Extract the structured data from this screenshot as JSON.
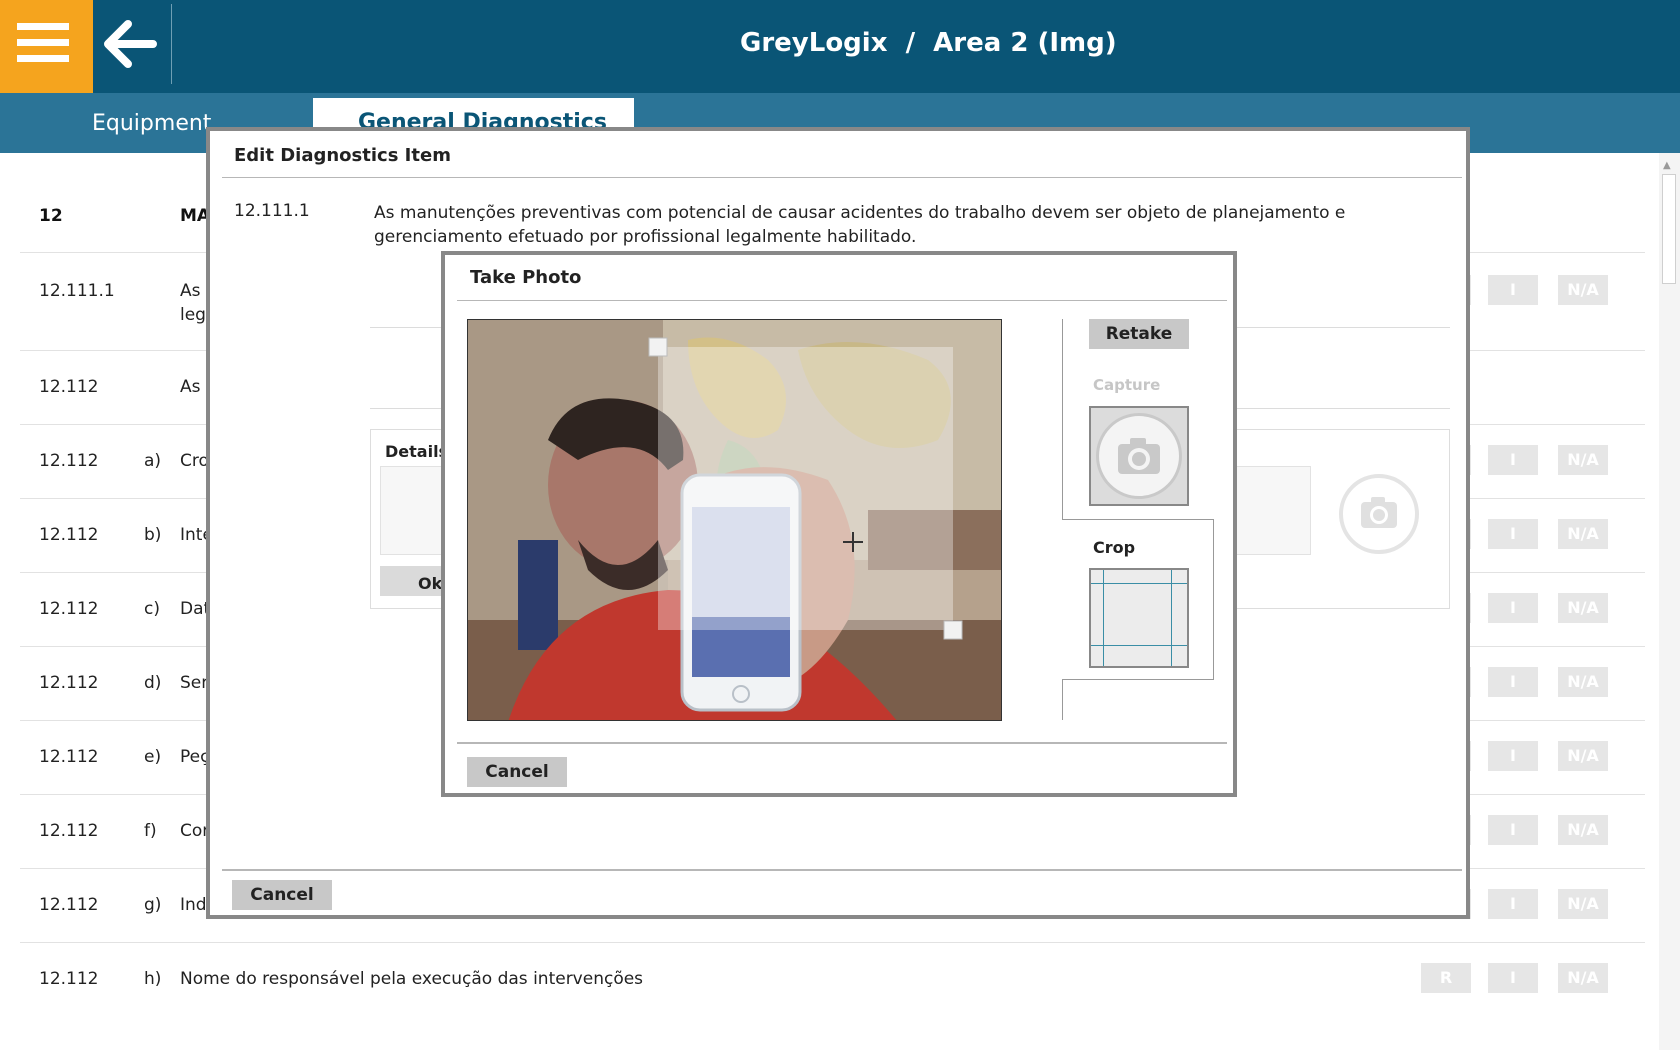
{
  "header": {
    "title": "GreyLogix  /  Area 2 (Img)"
  },
  "tabs": {
    "equipment": "Equipment",
    "general": "General Diagnostics"
  },
  "list": {
    "head_num": "12",
    "head_text": "MA",
    "rows": [
      {
        "num": "12.111.1",
        "letter": "",
        "text": "As",
        "text2": "leg"
      },
      {
        "num": "12.112",
        "letter": "",
        "text": "As",
        "text2": ""
      },
      {
        "num": "12.112",
        "letter": "a)",
        "text": "Cro",
        "text2": ""
      },
      {
        "num": "12.112",
        "letter": "b)",
        "text": "Inte",
        "text2": ""
      },
      {
        "num": "12.112",
        "letter": "c)",
        "text": "Dat",
        "text2": ""
      },
      {
        "num": "12.112",
        "letter": "d)",
        "text": "Ser",
        "text2": ""
      },
      {
        "num": "12.112",
        "letter": "e)",
        "text": "Peç",
        "text2": ""
      },
      {
        "num": "12.112",
        "letter": "f)",
        "text": "Cor",
        "text2": ""
      },
      {
        "num": "12.112",
        "letter": "g)",
        "text": "Ind",
        "text2": ""
      },
      {
        "num": "12.112",
        "letter": "h)",
        "text": "Nome do responsável pela execução das intervenções",
        "text2": ""
      }
    ],
    "btn_r": "R",
    "btn_i": "I",
    "btn_na": "N/A"
  },
  "edit_dialog": {
    "title": "Edit Diagnostics Item",
    "item_id": "12.111.1",
    "item_text": "As manutenções preventivas com potencial de causar acidentes do trabalho devem ser objeto de planejamento e gerenciamento efetuado por profissional legalmente habilitado.",
    "details_label": "Details",
    "ok_label": "Ok",
    "cancel_label": "Cancel"
  },
  "photo_dialog": {
    "title": "Take Photo",
    "retake_label": "Retake",
    "capture_label": "Capture",
    "crop_label": "Crop",
    "cancel_label": "Cancel"
  },
  "colors": {
    "header_bg": "#0a5576",
    "tabbar_bg": "#2b7497",
    "menu_accent": "#f5a41e"
  }
}
